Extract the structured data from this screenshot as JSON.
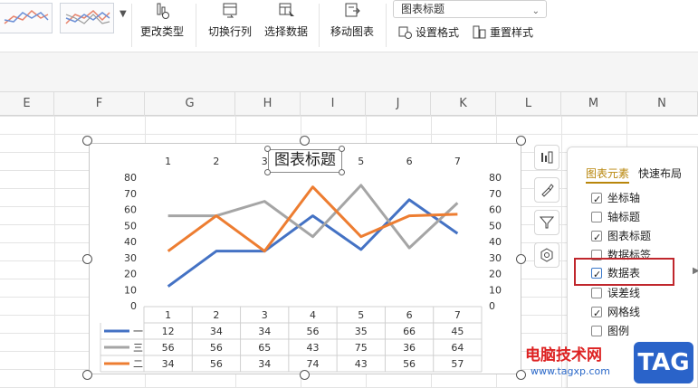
{
  "ribbon": {
    "change_type": "更改类型",
    "switch_row_col": "切换行列",
    "select_data": "选择数据",
    "move_chart": "移动图表",
    "chart_element_select": "图表标题",
    "set_format": "设置格式",
    "reset_style": "重置样式"
  },
  "columns": [
    "E",
    "F",
    "G",
    "H",
    "I",
    "J",
    "K",
    "L",
    "M",
    "N"
  ],
  "chart": {
    "title": "图表标题",
    "chart_data": {
      "type": "line",
      "categories": [
        "1",
        "2",
        "3",
        "4",
        "5",
        "6",
        "7"
      ],
      "series": [
        {
          "name": "一",
          "values": [
            12,
            34,
            34,
            56,
            35,
            66,
            45
          ],
          "color": "#4472c4"
        },
        {
          "name": "三",
          "values": [
            56,
            56,
            65,
            43,
            75,
            36,
            64
          ],
          "color": "#a5a5a5"
        },
        {
          "name": "二",
          "values": [
            34,
            56,
            34,
            74,
            43,
            56,
            57
          ],
          "color": "#ed7d31"
        }
      ],
      "yticks": [
        "0",
        "10",
        "20",
        "30",
        "40",
        "50",
        "60",
        "70",
        "80"
      ],
      "ylim": [
        0,
        80
      ],
      "title": "图表标题",
      "grid": false,
      "data_table": true
    }
  },
  "panel": {
    "tab_elements": "图表元素",
    "tab_layout": "快速布局",
    "items": [
      {
        "label": "坐标轴",
        "checked": true
      },
      {
        "label": "轴标题",
        "checked": false
      },
      {
        "label": "图表标题",
        "checked": true
      },
      {
        "label": "数据标签",
        "checked": false
      },
      {
        "label": "数据表",
        "checked": true
      },
      {
        "label": "误差线",
        "checked": false
      },
      {
        "label": "网格线",
        "checked": true
      },
      {
        "label": "图例",
        "checked": false
      }
    ]
  },
  "watermark": {
    "text": "电脑技术网",
    "url": "www.tagxp.com",
    "tag": "TAG"
  }
}
